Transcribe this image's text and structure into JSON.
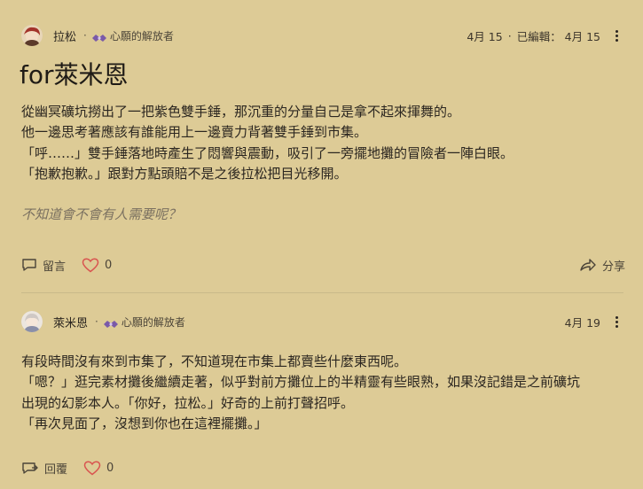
{
  "post1": {
    "author": "拉松",
    "dot": "·",
    "badge": "心願的解放者",
    "date": "4月 15",
    "sep": "·",
    "edited": "已編輯： 4月 15",
    "title": "for萊米恩",
    "lines": [
      "從幽冥礦坑撈出了一把紫色雙手錘，那沉重的分量自己是拿不起來揮舞的。",
      "他一邊思考著應該有誰能用上一邊賣力背著雙手錘到市集。",
      "「呼……」雙手錘落地時產生了悶響與震動，吸引了一旁擺地攤的冒險者一陣白眼。",
      "「抱歉抱歉。」跟對方點頭賠不是之後拉松把目光移開。",
      "",
      "不知道會不會有人需要呢？"
    ],
    "comment_label": "留言",
    "like_count": "0",
    "share_label": "分享"
  },
  "post2": {
    "author": "萊米恩",
    "dot": "·",
    "badge": "心願的解放者",
    "date": "4月 19",
    "lines": [
      "有段時間沒有來到市集了，不知道現在市集上都賣些什麼東西呢。",
      "「嗯？」逛完素材攤後繼續走著，似乎對前方攤位上的半精靈有些眼熟，如果沒記錯是之前礦坑",
      "出現的幻影本人。「你好，拉松。」好奇的上前打聲招呼。",
      "「再次見面了，沒想到你也在這裡擺攤。」"
    ],
    "reply_label": "回覆",
    "like_count": "0"
  },
  "colors": {
    "background": "#ddcb96",
    "heart": "#d9534f",
    "badge": "#7a5aa8"
  }
}
